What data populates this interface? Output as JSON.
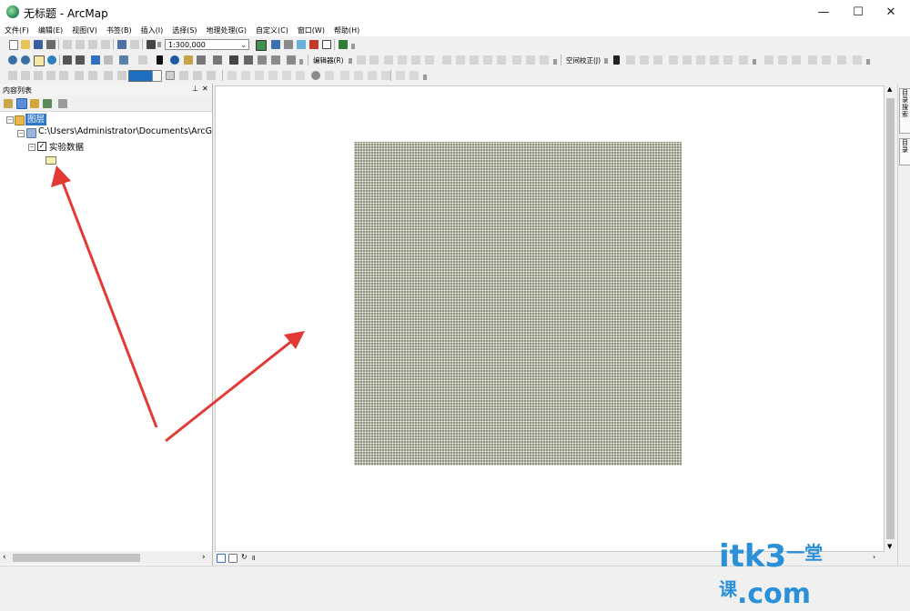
{
  "window": {
    "title": "无标题 - ArcMap",
    "minimize": "—",
    "maximize": "☐",
    "close": "✕"
  },
  "menu": [
    "文件(F)",
    "编辑(E)",
    "视图(V)",
    "书签(B)",
    "插入(I)",
    "选择(S)",
    "地理处理(G)",
    "自定义(C)",
    "窗口(W)",
    "帮助(H)"
  ],
  "toolbar": {
    "scale_value": "1:300,000",
    "editor_label": "编辑器(R)",
    "georef_label": "空间校正(J)"
  },
  "toc": {
    "title": "内容列表",
    "pin": "⊥",
    "close": "✕",
    "layers_label": "图层",
    "path_label": "C:\\Users\\Administrator\\Documents\\ArcG",
    "layer_name": "实验数据",
    "layer_checked": true
  },
  "right_tabs": [
    "目录搜索",
    "目录"
  ],
  "colors": {
    "raster": "#8e9079",
    "arrow": "#e23b36",
    "selection": "#2d76c9",
    "watermark": "#2b90d8"
  },
  "watermark": {
    "text": "itk3",
    "cn": "一堂课",
    "dom": ".com"
  }
}
